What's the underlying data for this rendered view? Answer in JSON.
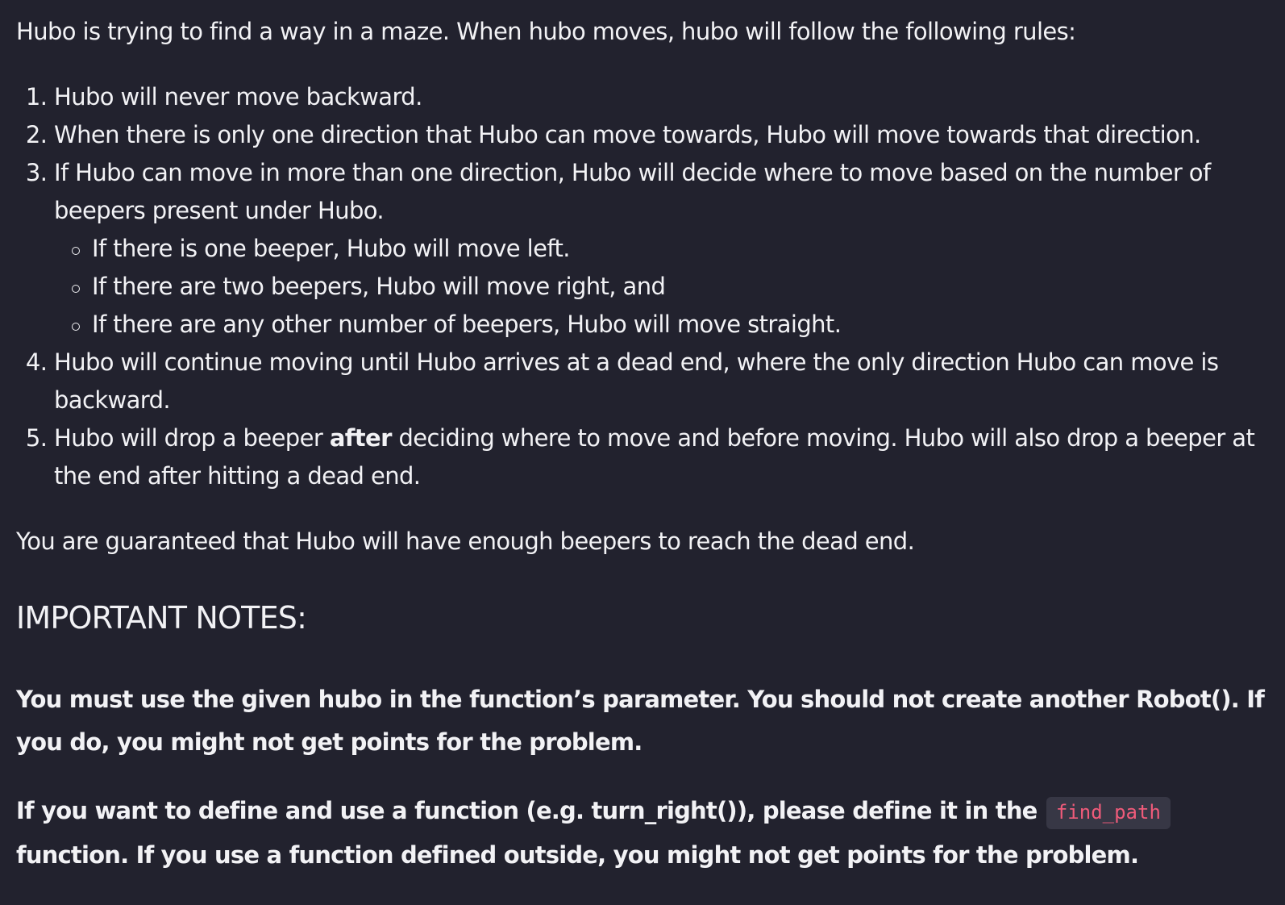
{
  "intro": "Hubo is trying to find a way in a maze. When hubo moves, hubo will follow the following rules:",
  "rules": [
    "Hubo will never move backward.",
    "When there is only one direction that Hubo can move towards, Hubo will move towards that direction.",
    "If Hubo can move in more than one direction, Hubo will decide where to move based on the number of beepers present under Hubo.",
    "Hubo will continue moving until Hubo arrives at a dead end, where the only direction Hubo can move is backward."
  ],
  "sub_rules": [
    "If there is one beeper, Hubo will move left.",
    "If there are two beepers, Hubo will move right, and",
    "If there are any other number of beepers, Hubo will move straight."
  ],
  "rule5": {
    "before": "Hubo will drop a beeper ",
    "emphasis": "after",
    "after": " deciding where to move and before moving. Hubo will also drop a beeper at the end after hitting a dead end."
  },
  "guarantee": "You are guaranteed that Hubo will have enough beepers to reach the dead end.",
  "notes_heading": "IMPORTANT NOTES:",
  "note1": "You must use the given hubo in the function’s parameter. You should not create another Robot(). If you do, you might not get points for the problem.",
  "note2": {
    "before": "If you want to define and use a function (e.g. turn_right()), please define it in the ",
    "code": "find_path",
    "after": " function. If you use a function defined outside, you might not get points for the problem."
  }
}
